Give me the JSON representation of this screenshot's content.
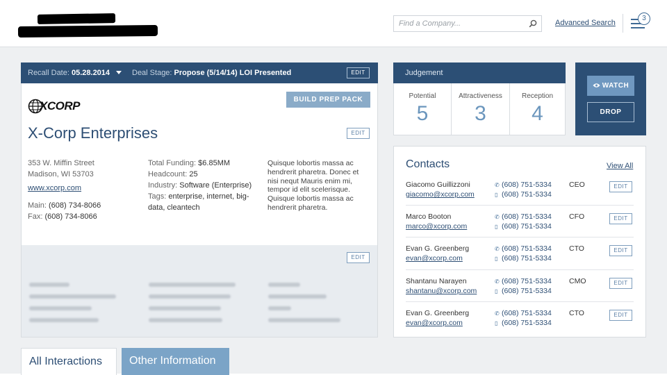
{
  "header": {
    "search_placeholder": "Find a Company...",
    "advanced_search": "Advanced Search",
    "notification_count": "3"
  },
  "company": {
    "recall_label": "Recall Date:",
    "recall_value": "05.28.2014",
    "stage_label": "Deal Stage:",
    "stage_value": "Propose (5/14/14) LOI Presented",
    "edit_label": "EDIT",
    "build_prep": "BUILD PREP PACK",
    "logo_text": "XCORP",
    "name": "X-Corp Enterprises",
    "address1": "353 W. Miffin Street",
    "address2": "Madison, WI 53703",
    "website": "www.xcorp.com",
    "main_label": "Main:",
    "main_phone": "(608) 734-8066",
    "fax_label": "Fax:",
    "fax_phone": "(608) 734-8066",
    "funding_label": "Total Funding:",
    "funding_value": "$6.85MM",
    "headcount_label": "Headcount:",
    "headcount_value": "25",
    "industry_label": "Industry:",
    "industry_value": "Software (Enterprise)",
    "tags_label": "Tags:",
    "tags_value": "enterprise, internet, big-data, cleantech",
    "description": "Quisque lobortis massa ac hendrerit pharetra. Donec et nisi nequt Mauris enim mi, tempor id elit scelerisque. Quisque lobortis massa ac hendrerit pharetra."
  },
  "judgement": {
    "title": "Judgement",
    "items": [
      {
        "label": "Potential",
        "value": "5"
      },
      {
        "label": "Attractiveness",
        "value": "3"
      },
      {
        "label": "Reception",
        "value": "4"
      }
    ]
  },
  "actions": {
    "watch": "WATCH",
    "drop": "DROP"
  },
  "contacts": {
    "title": "Contacts",
    "view_all": "View All",
    "edit_label": "EDIT",
    "rows": [
      {
        "name": "Giacomo Guillizzoni",
        "email": "giacomo@xcorp.com",
        "phone": "(608) 751-5334",
        "mobile": "(608) 751-5334",
        "role": "CEO"
      },
      {
        "name": "Marco Booton",
        "email": "marco@xcorp.com",
        "phone": "(608) 751-5334",
        "mobile": "(608) 751-5334",
        "role": "CFO"
      },
      {
        "name": "Evan G. Greenberg",
        "email": "evan@xcorp.com",
        "phone": "(608) 751-5334",
        "mobile": "(608) 751-5334",
        "role": "CTO"
      },
      {
        "name": "Shantanu Narayen",
        "email": "shantanu@xcorp.com",
        "phone": "(608) 751-5334",
        "mobile": "(608) 751-5334",
        "role": "CMO"
      },
      {
        "name": "Evan G. Greenberg",
        "email": "evan@xcorp.com",
        "phone": "(608) 751-5334",
        "mobile": "(608) 751-5334",
        "role": "CTO"
      }
    ]
  },
  "tabs": {
    "active": "All Interactions",
    "other": "Other Information"
  },
  "colors": {
    "brand_dark": "#2c4f75",
    "accent": "#6f98c0",
    "link": "#2d4e74"
  }
}
